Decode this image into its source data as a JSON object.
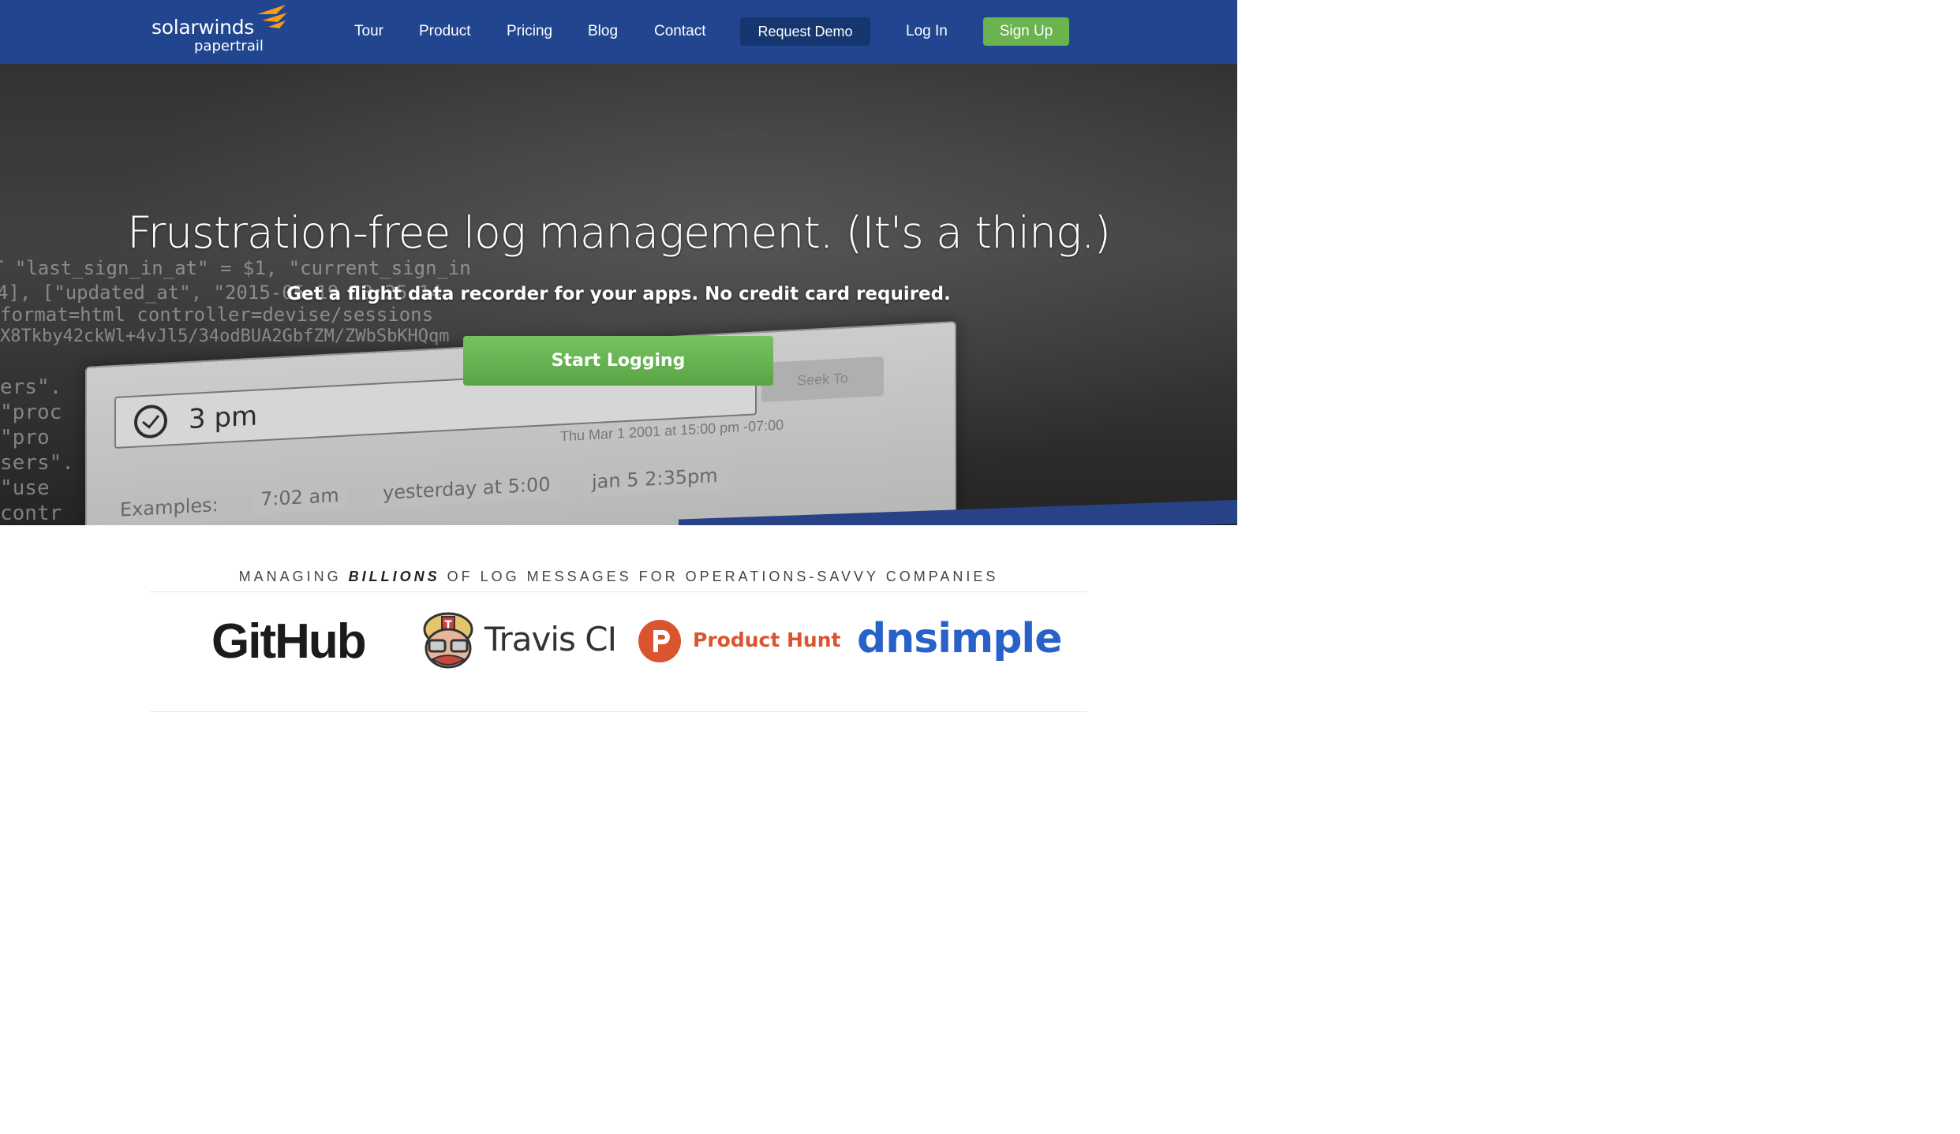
{
  "brand": {
    "name": "solarwinds",
    "product": "papertrail"
  },
  "nav": {
    "links": [
      "Tour",
      "Product",
      "Pricing",
      "Blog",
      "Contact"
    ],
    "request_demo": "Request Demo",
    "login": "Log In",
    "signup": "Sign Up"
  },
  "hero": {
    "headline": "Frustration-free log management. (It's a thing.)",
    "subline": "Get a flight data recorder for your apps. No credit card required.",
    "cta": "Start Logging",
    "screenshot": {
      "time_input": "3 pm",
      "examples_label": "Examples:",
      "examples": [
        "7:02 am",
        "yesterday at 5:00",
        "jan 5 2:35pm"
      ],
      "date_line": "Thu Mar 1 2001 at 15:00 pm -07:00",
      "saved_button": "Seek To",
      "code_lines": [
        "T \"last_sign_in_at\" = $1, \"current_sign_in",
        "4], [\"updated_at\", \"2015-05-19 13:25:14",
        "format=html controller=devise/sessions",
        "X8Tkby42ckWl+4vJl5/34odBUA2GbfZM/ZWbSbKHQqm",
        "ers\".",
        "\"proc",
        "\"pro",
        "sers\".",
        "\"use",
        "contr"
      ]
    }
  },
  "customers": {
    "tagline_pre": "MANAGING ",
    "tagline_bold": "BILLIONS",
    "tagline_post": " OF LOG MESSAGES FOR OPERATIONS-SAVVY COMPANIES",
    "logos": [
      "GitHub",
      "Travis CI",
      "Product Hunt",
      "dnsimple"
    ]
  }
}
